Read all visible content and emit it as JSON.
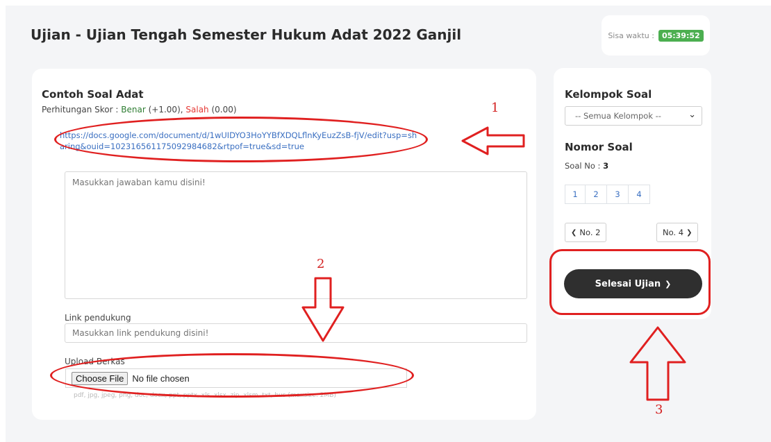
{
  "page": {
    "title": "Ujian - Ujian Tengah Semester Hukum Adat 2022 Ganjil"
  },
  "timer": {
    "label": "Sisa waktu :",
    "value": "05:39:52"
  },
  "question": {
    "title": "Contoh Soal Adat",
    "score_prefix": "Perhitungan Skor :",
    "benar_label": "Benar",
    "benar_value": "(+1.00),",
    "salah_label": "Salah",
    "salah_value": "(0.00)",
    "link_text": "https://docs.google.com/document/d/1wUIDYO3HoYYBfXDQLflnKyEuzZsB-fjV/edit?usp=sharing&ouid=102316561175092984682&rtpof=true&sd=true",
    "answer_placeholder": "Masukkan jawaban kamu disini!",
    "support_label": "Link pendukung",
    "support_placeholder": "Masukkan link pendukung disini!",
    "upload_label": "Upload Berkas",
    "choose_file": "Choose File",
    "no_file": "No file chosen",
    "file_hint": "pdf, jpg, jpeg, png, doc, docx, ppt, pptx, xls, xlsx, zip, xlsm, txt, bus (maxsize: 2MB)"
  },
  "sidebar": {
    "group_heading": "Kelompok Soal",
    "group_select": "-- Semua Kelompok --",
    "number_heading": "Nomor Soal",
    "soal_no_label": "Soal No :",
    "soal_no_value": "3",
    "pages": [
      "1",
      "2",
      "3",
      "4"
    ],
    "prev_label": "No. 2",
    "next_label": "No. 4",
    "finish_label": "Selesai Ujian"
  },
  "annotations": {
    "num1": "1",
    "num2": "2",
    "num3": "3",
    "color": "#e02020"
  },
  "icons": {
    "chevron_left": "❮",
    "chevron_right": "❯",
    "dropdown": "⌄"
  }
}
